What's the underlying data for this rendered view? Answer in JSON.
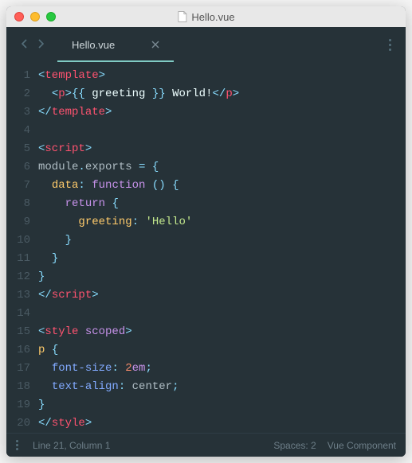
{
  "window": {
    "title": "Hello.vue"
  },
  "tab": {
    "label": "Hello.vue"
  },
  "status": {
    "cursor": "Line 21, Column 1",
    "spaces": "Spaces: 2",
    "lang": "Vue Component"
  },
  "code": {
    "lines": [
      [
        {
          "cls": "tk-punc",
          "t": "<"
        },
        {
          "cls": "tk-tag",
          "t": "template"
        },
        {
          "cls": "tk-punc",
          "t": ">"
        }
      ],
      [
        {
          "cls": "tk-plain",
          "t": "  "
        },
        {
          "cls": "tk-punc",
          "t": "<"
        },
        {
          "cls": "tk-tag",
          "t": "p"
        },
        {
          "cls": "tk-punc",
          "t": ">"
        },
        {
          "cls": "tk-punc",
          "t": "{{ "
        },
        {
          "cls": "tk-text",
          "t": "greeting"
        },
        {
          "cls": "tk-punc",
          "t": " }} "
        },
        {
          "cls": "tk-text",
          "t": "World!"
        },
        {
          "cls": "tk-punc",
          "t": "</"
        },
        {
          "cls": "tk-tag",
          "t": "p"
        },
        {
          "cls": "tk-punc",
          "t": ">"
        }
      ],
      [
        {
          "cls": "tk-punc",
          "t": "</"
        },
        {
          "cls": "tk-tag",
          "t": "template"
        },
        {
          "cls": "tk-punc",
          "t": ">"
        }
      ],
      [],
      [
        {
          "cls": "tk-punc",
          "t": "<"
        },
        {
          "cls": "tk-tag",
          "t": "script"
        },
        {
          "cls": "tk-punc",
          "t": ">"
        }
      ],
      [
        {
          "cls": "tk-plain",
          "t": "module"
        },
        {
          "cls": "tk-punc",
          "t": "."
        },
        {
          "cls": "tk-plain",
          "t": "exports "
        },
        {
          "cls": "tk-punc",
          "t": "= {"
        }
      ],
      [
        {
          "cls": "tk-plain",
          "t": "  "
        },
        {
          "cls": "tk-obj",
          "t": "data"
        },
        {
          "cls": "tk-punc",
          "t": ": "
        },
        {
          "cls": "tk-key",
          "t": "function"
        },
        {
          "cls": "tk-plain",
          "t": " "
        },
        {
          "cls": "tk-punc",
          "t": "()"
        },
        {
          "cls": "tk-plain",
          "t": " "
        },
        {
          "cls": "tk-punc",
          "t": "{"
        }
      ],
      [
        {
          "cls": "tk-plain",
          "t": "    "
        },
        {
          "cls": "tk-key",
          "t": "return"
        },
        {
          "cls": "tk-plain",
          "t": " "
        },
        {
          "cls": "tk-punc",
          "t": "{"
        }
      ],
      [
        {
          "cls": "tk-plain",
          "t": "      "
        },
        {
          "cls": "tk-obj",
          "t": "greeting"
        },
        {
          "cls": "tk-punc",
          "t": ": "
        },
        {
          "cls": "tk-str",
          "t": "'Hello'"
        }
      ],
      [
        {
          "cls": "tk-plain",
          "t": "    "
        },
        {
          "cls": "tk-punc",
          "t": "}"
        }
      ],
      [
        {
          "cls": "tk-plain",
          "t": "  "
        },
        {
          "cls": "tk-punc",
          "t": "}"
        }
      ],
      [
        {
          "cls": "tk-punc",
          "t": "}"
        }
      ],
      [
        {
          "cls": "tk-punc",
          "t": "</"
        },
        {
          "cls": "tk-tag",
          "t": "script"
        },
        {
          "cls": "tk-punc",
          "t": ">"
        }
      ],
      [],
      [
        {
          "cls": "tk-punc",
          "t": "<"
        },
        {
          "cls": "tk-tag",
          "t": "style"
        },
        {
          "cls": "tk-plain",
          "t": " "
        },
        {
          "cls": "tk-attr",
          "t": "scoped"
        },
        {
          "cls": "tk-punc",
          "t": ">"
        }
      ],
      [
        {
          "cls": "tk-obj",
          "t": "p"
        },
        {
          "cls": "tk-plain",
          "t": " "
        },
        {
          "cls": "tk-punc",
          "t": "{"
        }
      ],
      [
        {
          "cls": "tk-plain",
          "t": "  "
        },
        {
          "cls": "tk-func",
          "t": "font-size"
        },
        {
          "cls": "tk-punc",
          "t": ": "
        },
        {
          "cls": "tk-num",
          "t": "2"
        },
        {
          "cls": "tk-key",
          "t": "em"
        },
        {
          "cls": "tk-punc",
          "t": ";"
        }
      ],
      [
        {
          "cls": "tk-plain",
          "t": "  "
        },
        {
          "cls": "tk-func",
          "t": "text-align"
        },
        {
          "cls": "tk-punc",
          "t": ": "
        },
        {
          "cls": "tk-plain",
          "t": "center"
        },
        {
          "cls": "tk-punc",
          "t": ";"
        }
      ],
      [
        {
          "cls": "tk-punc",
          "t": "}"
        }
      ],
      [
        {
          "cls": "tk-punc",
          "t": "</"
        },
        {
          "cls": "tk-tag",
          "t": "style"
        },
        {
          "cls": "tk-punc",
          "t": ">"
        }
      ]
    ]
  }
}
